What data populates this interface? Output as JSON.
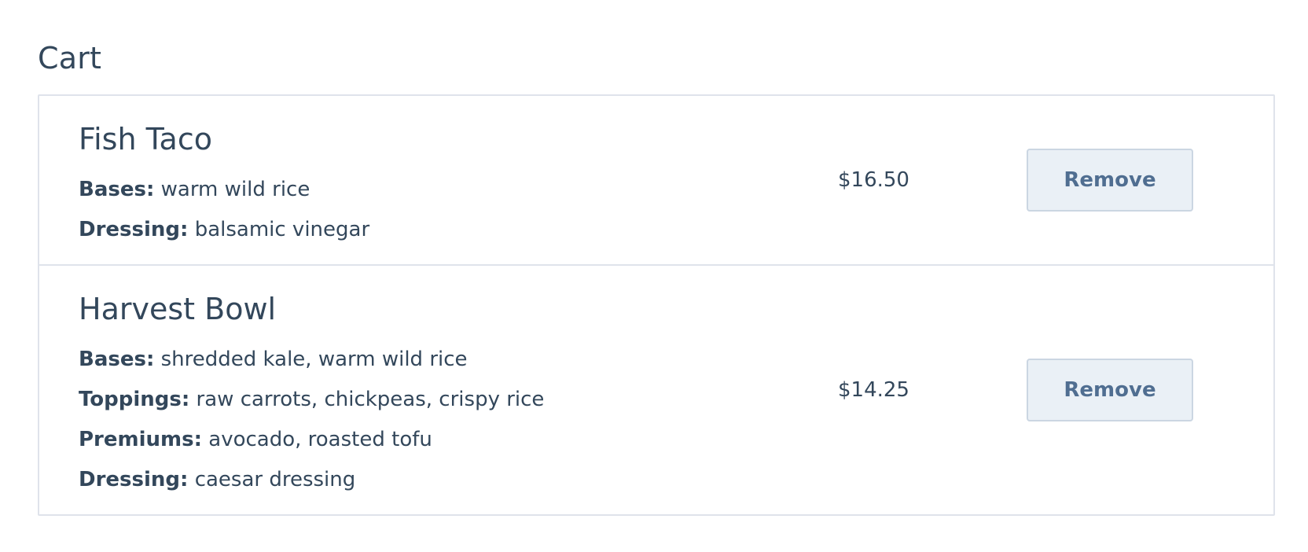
{
  "cart": {
    "title": "Cart",
    "items": [
      {
        "name": "Fish Taco",
        "details": [
          {
            "label": "Bases:",
            "value": "warm wild rice"
          },
          {
            "label": "Dressing:",
            "value": "balsamic vinegar"
          }
        ],
        "price": "$16.50",
        "remove_label": "Remove"
      },
      {
        "name": "Harvest Bowl",
        "details": [
          {
            "label": "Bases:",
            "value": "shredded kale, warm wild rice"
          },
          {
            "label": "Toppings:",
            "value": "raw carrots, chickpeas, crispy rice"
          },
          {
            "label": "Premiums:",
            "value": "avocado, roasted tofu"
          },
          {
            "label": "Dressing:",
            "value": "caesar dressing"
          }
        ],
        "price": "$14.25",
        "remove_label": "Remove"
      }
    ]
  }
}
